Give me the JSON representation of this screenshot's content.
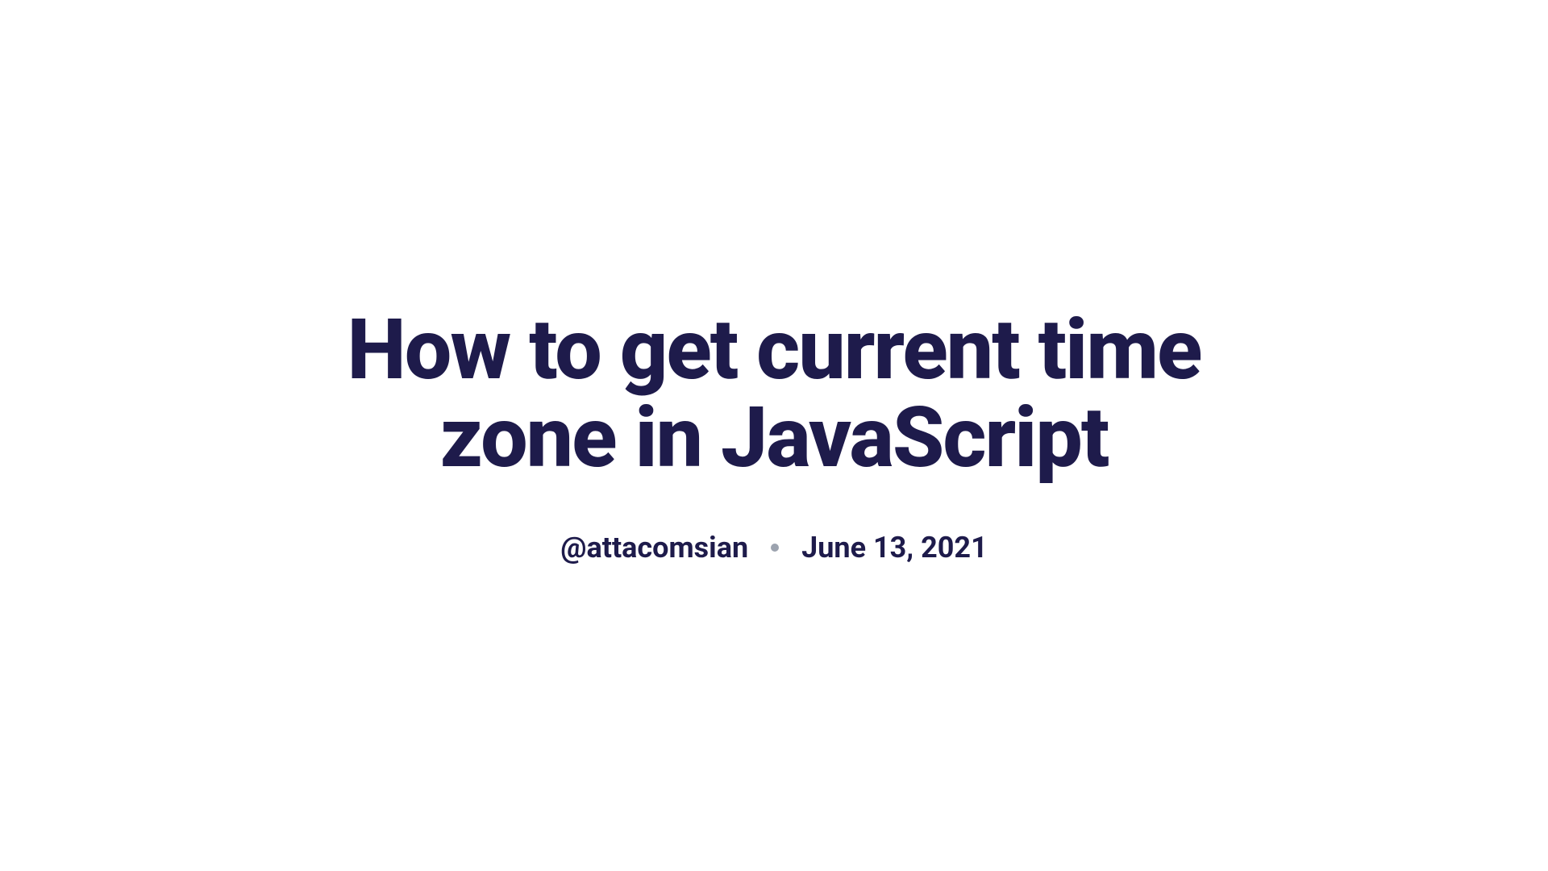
{
  "article": {
    "title": "How to get current time zone in JavaScript",
    "author": "@attacomsian",
    "date": "June 13, 2021"
  }
}
